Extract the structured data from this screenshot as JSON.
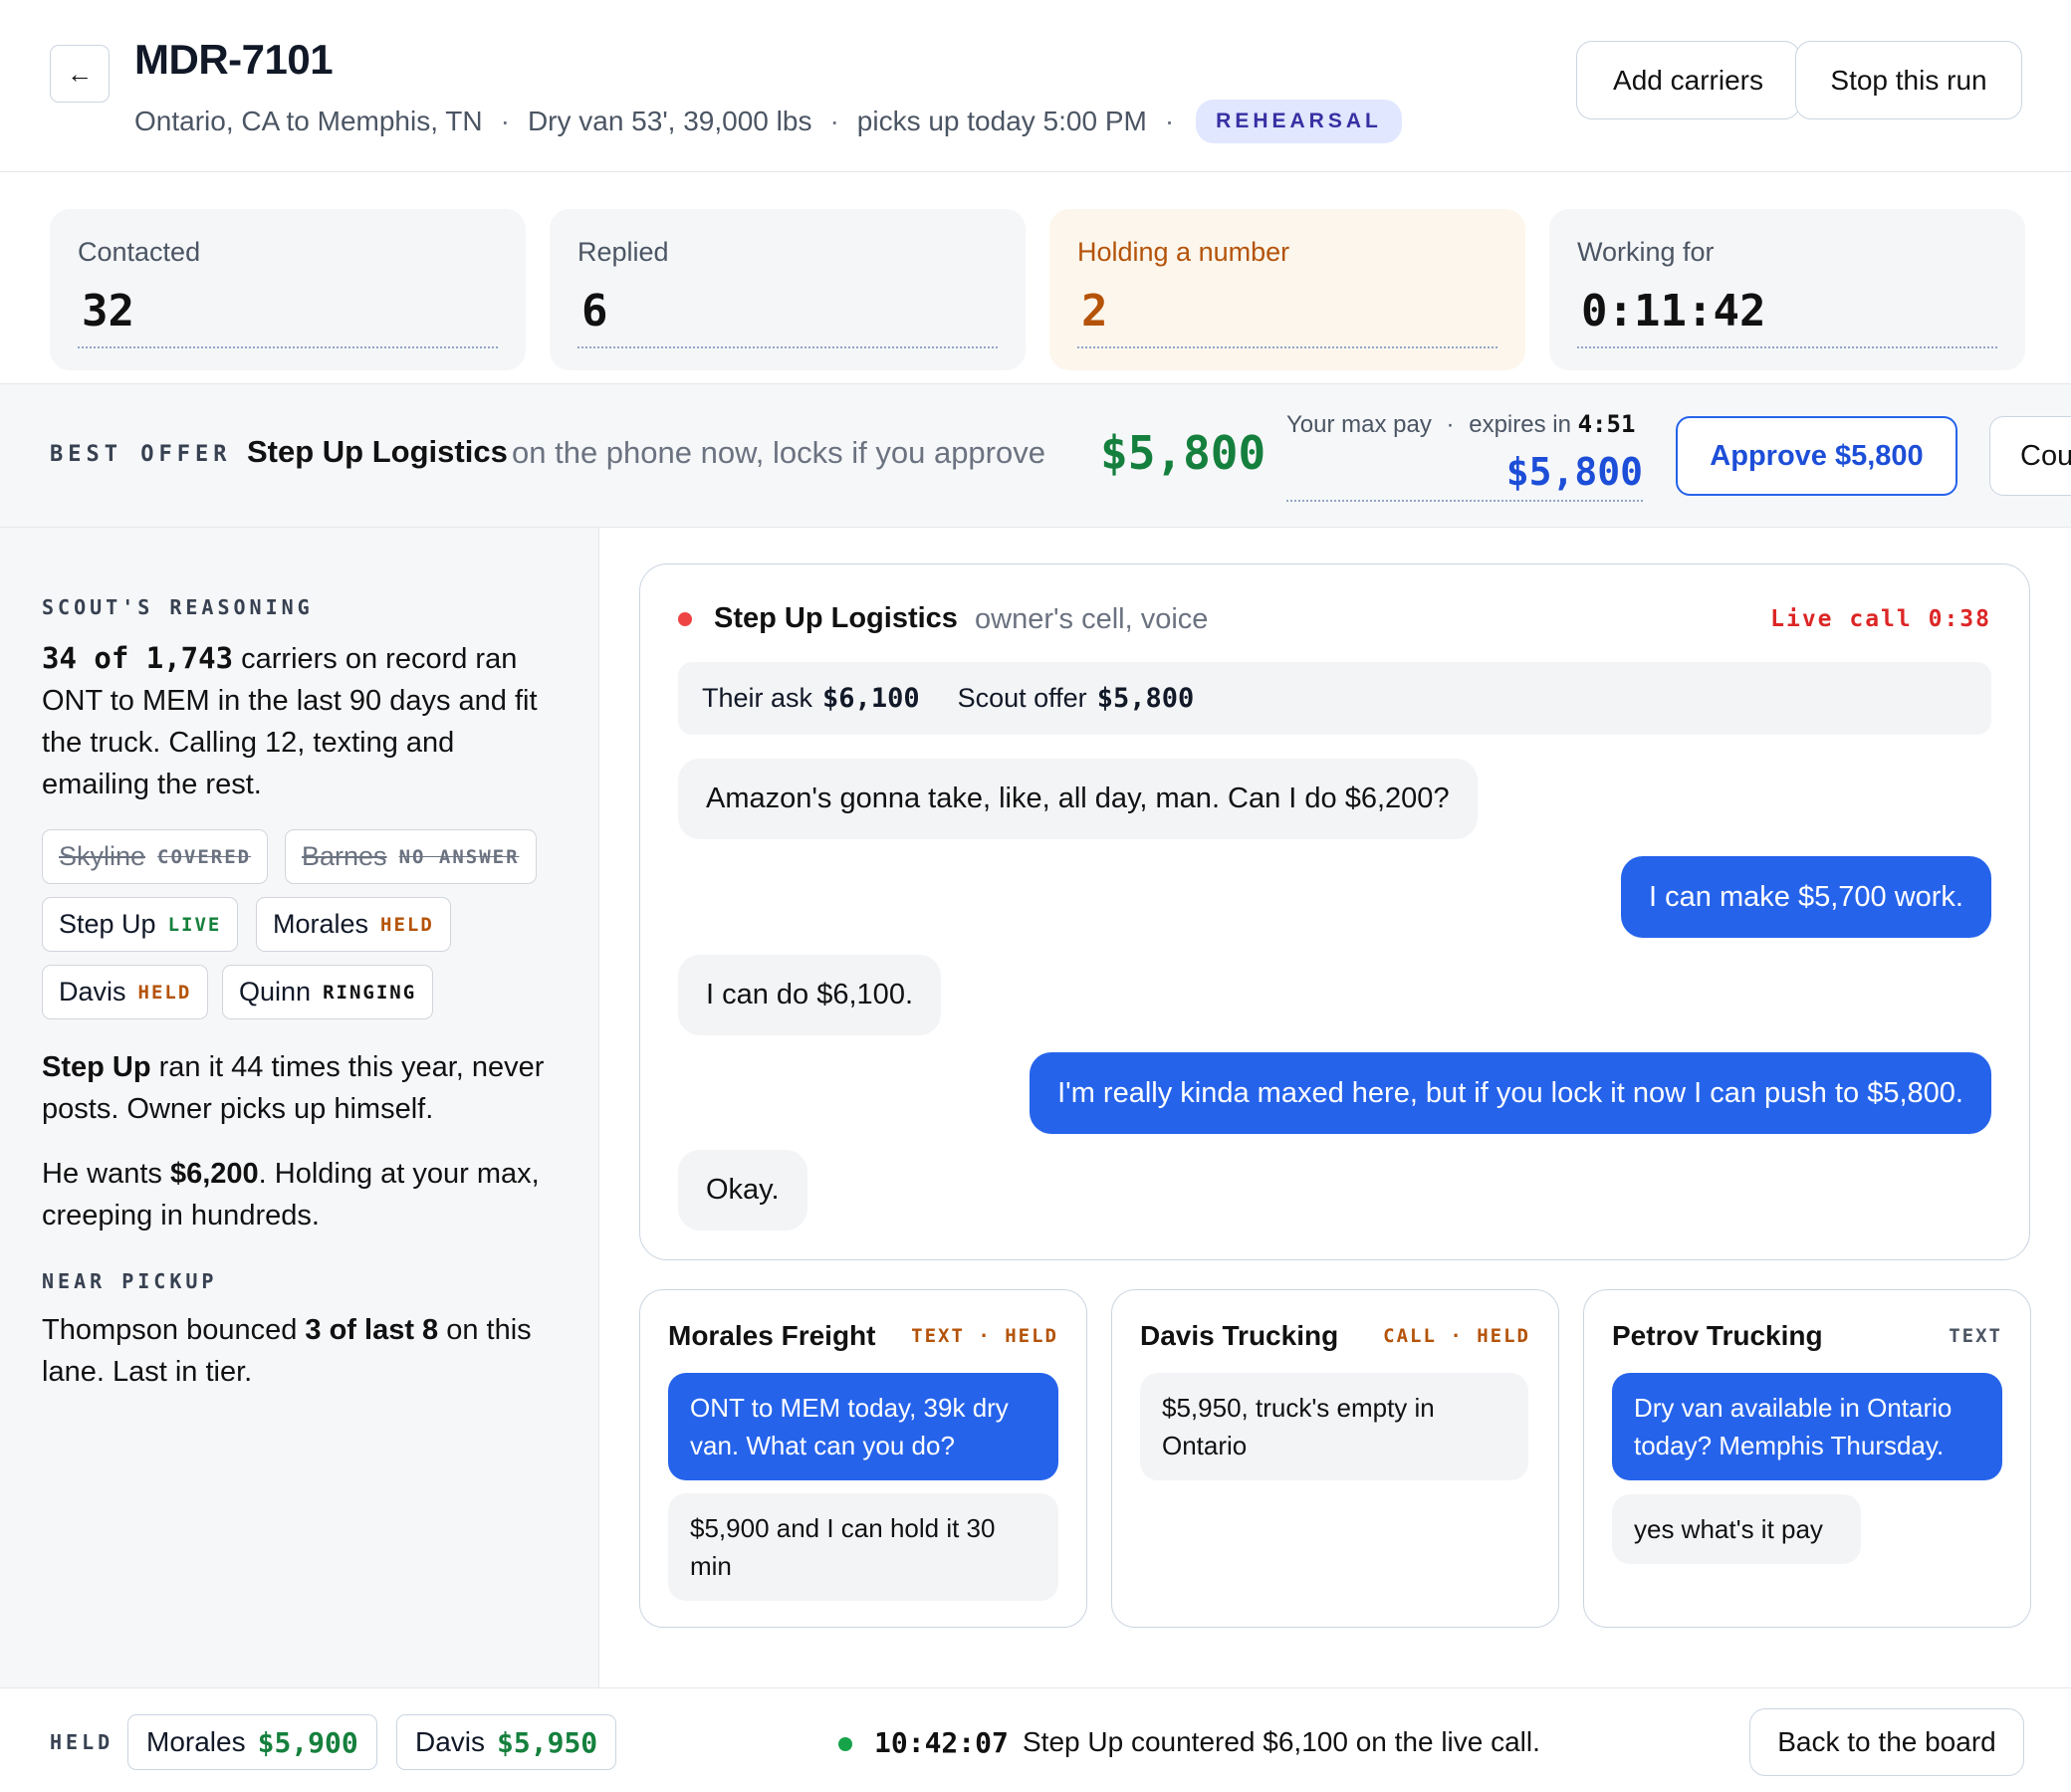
{
  "header": {
    "back_icon": "←",
    "title": "MDR-7101",
    "lane": "Ontario, CA to Memphis, TN",
    "equipment": "Dry van 53', 39,000 lbs",
    "pickup": "picks up today 5:00 PM",
    "separator": "·",
    "mode_badge": "REHEARSAL",
    "add_carriers_label": "Add carriers",
    "stop_run_label": "Stop this run"
  },
  "stats": [
    {
      "label": "Contacted",
      "value": "32"
    },
    {
      "label": "Replied",
      "value": "6"
    },
    {
      "label": "Holding a number",
      "value": "2"
    },
    {
      "label": "Working for",
      "value": "0:11:42"
    }
  ],
  "best_offer": {
    "tag": "BEST OFFER",
    "carrier": "Step Up Logistics",
    "note": "on the phone now, locks if you approve",
    "price": "$5,800",
    "max_label": "Your max pay",
    "expires_label": "expires in",
    "expires_value": "4:51",
    "max_value": "$5,800",
    "approve_label": "Approve $5,800",
    "counter_label": "Counter"
  },
  "sidebar": {
    "reasoning_heading": "SCOUT'S REASONING",
    "reasoning_count": "34 of 1,743",
    "reasoning_text": " carriers on record ran ONT to MEM in the last 90 days and fit the truck. Calling 12, texting and emailing the rest.",
    "chips": [
      {
        "name": "Skyline",
        "status": "COVERED"
      },
      {
        "name": "Barnes",
        "status": "NO ANSWER"
      },
      {
        "name": "Step Up",
        "status": "LIVE"
      },
      {
        "name": "Morales",
        "status": "HELD"
      },
      {
        "name": "Davis",
        "status": "HELD"
      },
      {
        "name": "Quinn",
        "status": "RINGING"
      }
    ],
    "stepup_name": "Step Up",
    "stepup_text": " ran it 44 times this year, never posts. Owner picks up himself.",
    "wants_prefix": "He wants ",
    "wants_value": "$6,200",
    "wants_suffix": ". Holding at your max, creeping in hundreds.",
    "near_pickup_heading": "NEAR PICKUP",
    "thompson_prefix": "Thompson bounced ",
    "thompson_value": "3 of last 8",
    "thompson_suffix": " on this lane. Last in tier."
  },
  "live_call": {
    "carrier": "Step Up Logistics",
    "channel": "owner's cell, voice",
    "status": "Live call 0:38",
    "their_ask_label": "Their ask",
    "their_ask_value": "$6,100",
    "scout_offer_label": "Scout offer",
    "scout_offer_value": "$5,800",
    "messages": [
      {
        "from": "carrier",
        "text": "Amazon's gonna take, like, all day, man. Can I do $6,200?"
      },
      {
        "from": "scout",
        "text": "I can make $5,700 work."
      },
      {
        "from": "carrier",
        "text": "I can do $6,100."
      },
      {
        "from": "scout",
        "text": "I'm really kinda maxed here, but if you lock it now I can push to $5,800."
      },
      {
        "from": "carrier",
        "text": "Okay."
      }
    ]
  },
  "threads": [
    {
      "name": "Morales Freight",
      "meta": "TEXT · HELD",
      "messages": [
        {
          "from": "scout",
          "text": "ONT to MEM today, 39k dry van. What can you do?"
        },
        {
          "from": "carrier",
          "text": "$5,900 and I can hold it 30 min"
        }
      ]
    },
    {
      "name": "Davis Trucking",
      "meta": "CALL · HELD",
      "messages": [
        {
          "from": "carrier",
          "text": "$5,950, truck's empty in Ontario"
        }
      ]
    },
    {
      "name": "Petrov Trucking",
      "meta": "TEXT",
      "messages": [
        {
          "from": "scout",
          "text": "Dry van available in Ontario today? Memphis Thursday."
        },
        {
          "from": "carrier",
          "text": "yes what's it pay"
        }
      ]
    }
  ],
  "footer": {
    "held_tag": "HELD",
    "held": [
      {
        "name": "Morales",
        "amount": "$5,900"
      },
      {
        "name": "Davis",
        "amount": "$5,950"
      }
    ],
    "event_time": "10:42:07",
    "event_text": "Step Up countered $6,100 on the live call.",
    "back_label": "Back to the board"
  },
  "colors": {
    "accent_blue": "#2563eb",
    "money_green": "#15803d",
    "held_amber": "#b45309",
    "live_red": "#dc2626"
  }
}
